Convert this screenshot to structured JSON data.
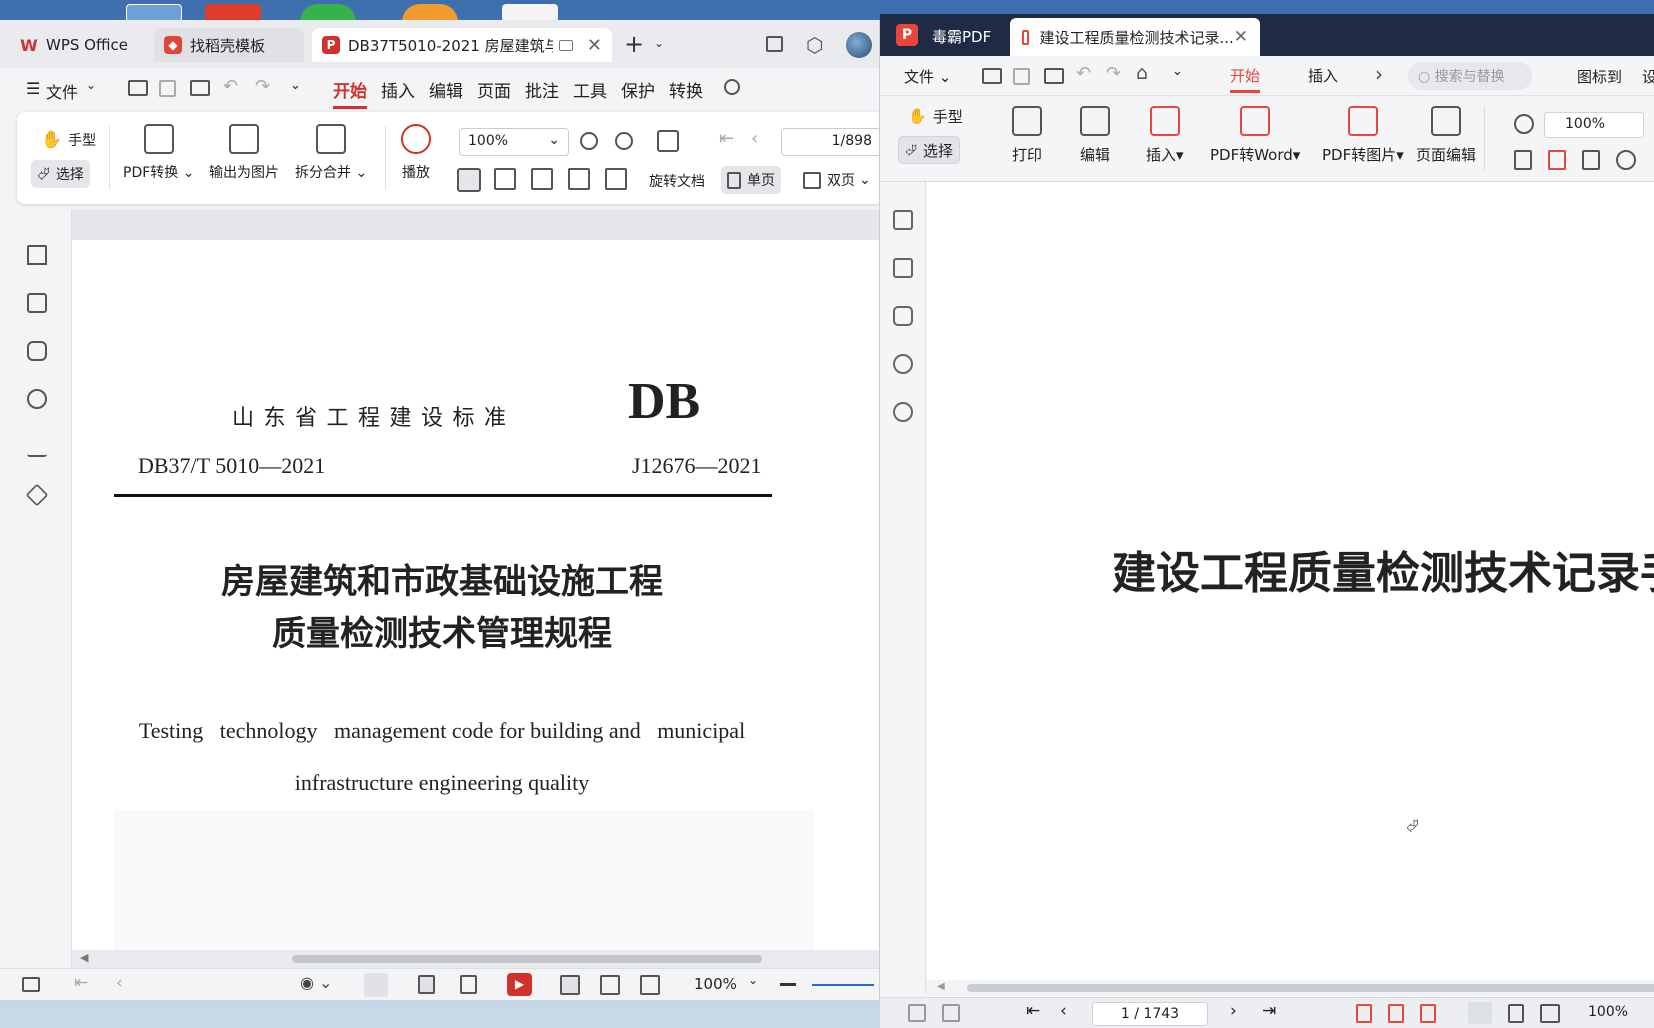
{
  "wps": {
    "tabs": [
      {
        "label": "WPS Office",
        "icon": "wps-logo-icon"
      },
      {
        "label": "找稻壳模板",
        "icon": "docer-icon"
      },
      {
        "label": "DB37T5010-2021 房屋建筑与",
        "icon": "pdf-icon"
      }
    ],
    "menu": {
      "file": "文件",
      "start": "开始",
      "insert": "插入",
      "edit": "编辑",
      "page": "页面",
      "annotate": "批注",
      "tools": "工具",
      "protect": "保护",
      "convert": "转换"
    },
    "ribbon": {
      "hand": "手型",
      "select": "选择",
      "pdf_convert": "PDF转换",
      "export_image": "输出为图片",
      "split_merge": "拆分合并",
      "play": "播放",
      "zoom": "100%",
      "page_indicator": "1/898",
      "rotate_doc": "旋转文档",
      "single_page": "单页",
      "double_page": "双页"
    },
    "document": {
      "province_standard": "山 东 省 工 程 建 设 标 准",
      "db_mark": "DB",
      "code_left": "DB37/T  5010—2021",
      "code_right": "J12676—2021",
      "title_line1": "房屋建筑和市政基础设施工程",
      "title_line2": "质量检测技术管理规程",
      "en_line1": "Testing   technology   management code for building and   municipal",
      "en_line2": "infrastructure engineering quality"
    },
    "status": {
      "zoom": "100%"
    }
  },
  "pdf": {
    "app_name": "毒霸PDF",
    "tab_title": "建设工程质量检测技术记录...",
    "toolbar": {
      "file": "文件",
      "start": "开始",
      "insert": "插入",
      "search_placeholder": "搜索与替换",
      "bookmark": "图标到",
      "more": "设"
    },
    "ribbon": {
      "hand": "手型",
      "select": "选择",
      "print": "打印",
      "edit": "编辑",
      "insert": "插入",
      "pdf_to_word": "PDF转Word",
      "pdf_to_image": "PDF转图片",
      "page_edit": "页面编辑",
      "zoom": "100%"
    },
    "document": {
      "title": "建设工程质量检测技术记录手"
    },
    "status": {
      "page_indicator": "1 / 1743",
      "zoom": "100%"
    }
  },
  "colors": {
    "wps_accent": "#d0312d",
    "pdf_header": "#1f2a44",
    "pdf_accent": "#e8453c"
  }
}
